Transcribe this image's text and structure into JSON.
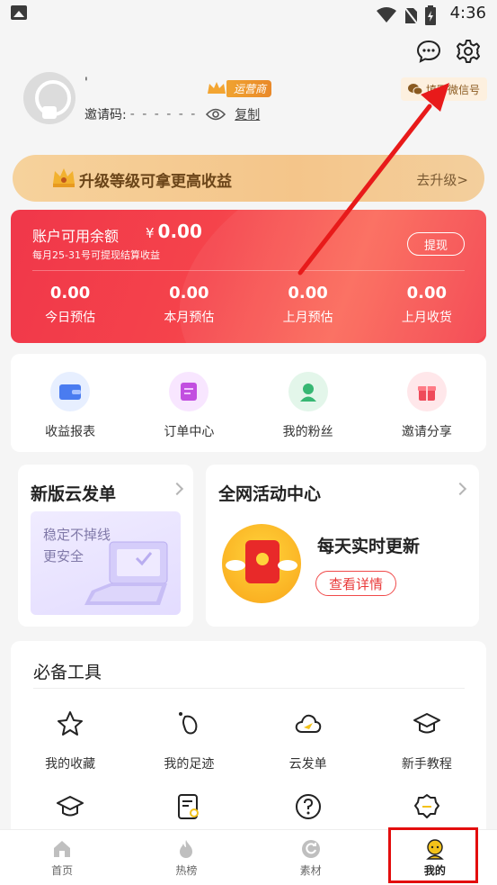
{
  "status_bar": {
    "time": "4:36"
  },
  "header": {
    "username": "'",
    "badge": "运营商",
    "invite_label": "邀请码:",
    "invite_code": "- - - - - -",
    "copy_label": "复制",
    "wechat_btn": "填写微信号"
  },
  "upgrade": {
    "text": "升级等级可拿更高收益",
    "action": "去升级>"
  },
  "balance": {
    "label": "账户可用余额",
    "currency": "¥",
    "amount": "0.00",
    "note": "每月25-31号可提现结算收益",
    "withdraw": "提现",
    "stats": [
      {
        "value": "0.00",
        "label": "今日预估"
      },
      {
        "value": "0.00",
        "label": "本月预估"
      },
      {
        "value": "0.00",
        "label": "上月预估"
      },
      {
        "value": "0.00",
        "label": "上月收货"
      }
    ]
  },
  "quick_menu": [
    {
      "label": "收益报表",
      "icon": "wallet-icon",
      "color": "#4a7cf0"
    },
    {
      "label": "订单中心",
      "icon": "order-icon",
      "color": "#c24fe0"
    },
    {
      "label": "我的粉丝",
      "icon": "fans-icon",
      "color": "#37b773"
    },
    {
      "label": "邀请分享",
      "icon": "gift-icon",
      "color": "#ef4a5a"
    }
  ],
  "cloud_card": {
    "title": "新版云发单",
    "line1": "稳定不掉线",
    "line2": "更安全"
  },
  "activity_card": {
    "title": "全网活动中心",
    "headline": "每天实时更新",
    "button": "查看详情"
  },
  "tools": {
    "title": "必备工具",
    "items": [
      {
        "label": "我的收藏",
        "icon": "star-icon"
      },
      {
        "label": "我的足迹",
        "icon": "footprint-icon"
      },
      {
        "label": "云发单",
        "icon": "cloud-send-icon"
      },
      {
        "label": "新手教程",
        "icon": "graduation-cap-icon"
      },
      {
        "label": "",
        "icon": "graduation-cap-icon"
      },
      {
        "label": "",
        "icon": "document-search-icon"
      },
      {
        "label": "",
        "icon": "help-icon"
      },
      {
        "label": "",
        "icon": "badge-icon"
      }
    ]
  },
  "nav": [
    {
      "label": "首页",
      "icon": "home-icon"
    },
    {
      "label": "热榜",
      "icon": "flame-icon"
    },
    {
      "label": "素材",
      "icon": "material-icon"
    },
    {
      "label": "我的",
      "icon": "user-icon"
    }
  ]
}
